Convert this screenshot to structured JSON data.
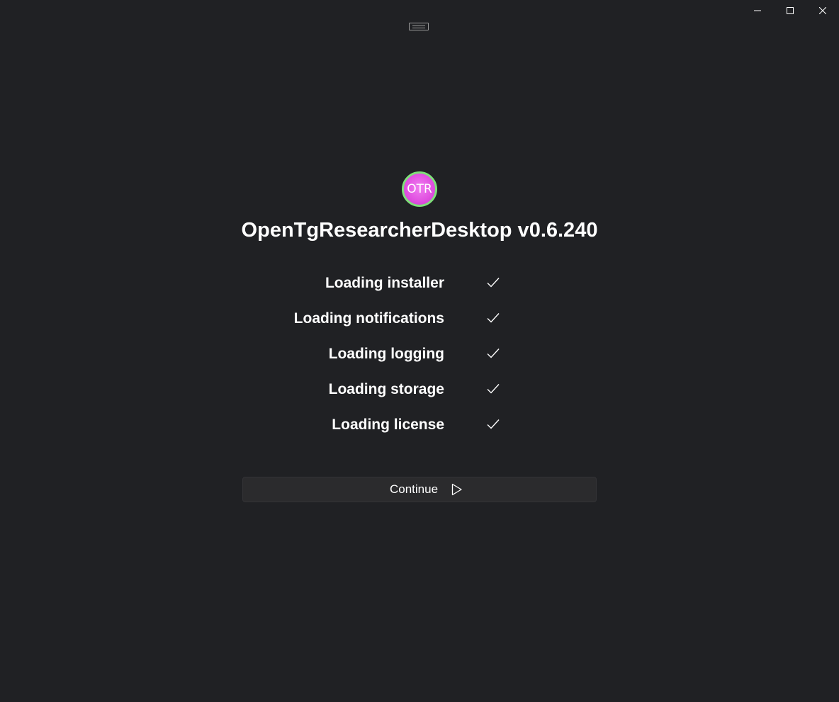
{
  "window": {
    "caption_buttons": [
      "minimize-icon",
      "maximize-icon",
      "close-icon"
    ]
  },
  "logo": {
    "text": "OTR",
    "colors": {
      "ring": "#7fe07a",
      "fill": "#e04fe0"
    }
  },
  "header": {
    "title": "OpenTgResearcherDesktop v0.6.240"
  },
  "steps": [
    {
      "label": "Loading installer",
      "status": "done",
      "icon": "check-icon"
    },
    {
      "label": "Loading notifications",
      "status": "done",
      "icon": "check-icon"
    },
    {
      "label": "Loading logging",
      "status": "done",
      "icon": "check-icon"
    },
    {
      "label": "Loading storage",
      "status": "done",
      "icon": "check-icon"
    },
    {
      "label": "Loading license",
      "status": "done",
      "icon": "check-icon"
    }
  ],
  "continue": {
    "label": "Continue",
    "icon": "play-icon"
  },
  "colors": {
    "background": "#202124",
    "text": "#ffffff",
    "button_background": "#2b2b2d"
  }
}
